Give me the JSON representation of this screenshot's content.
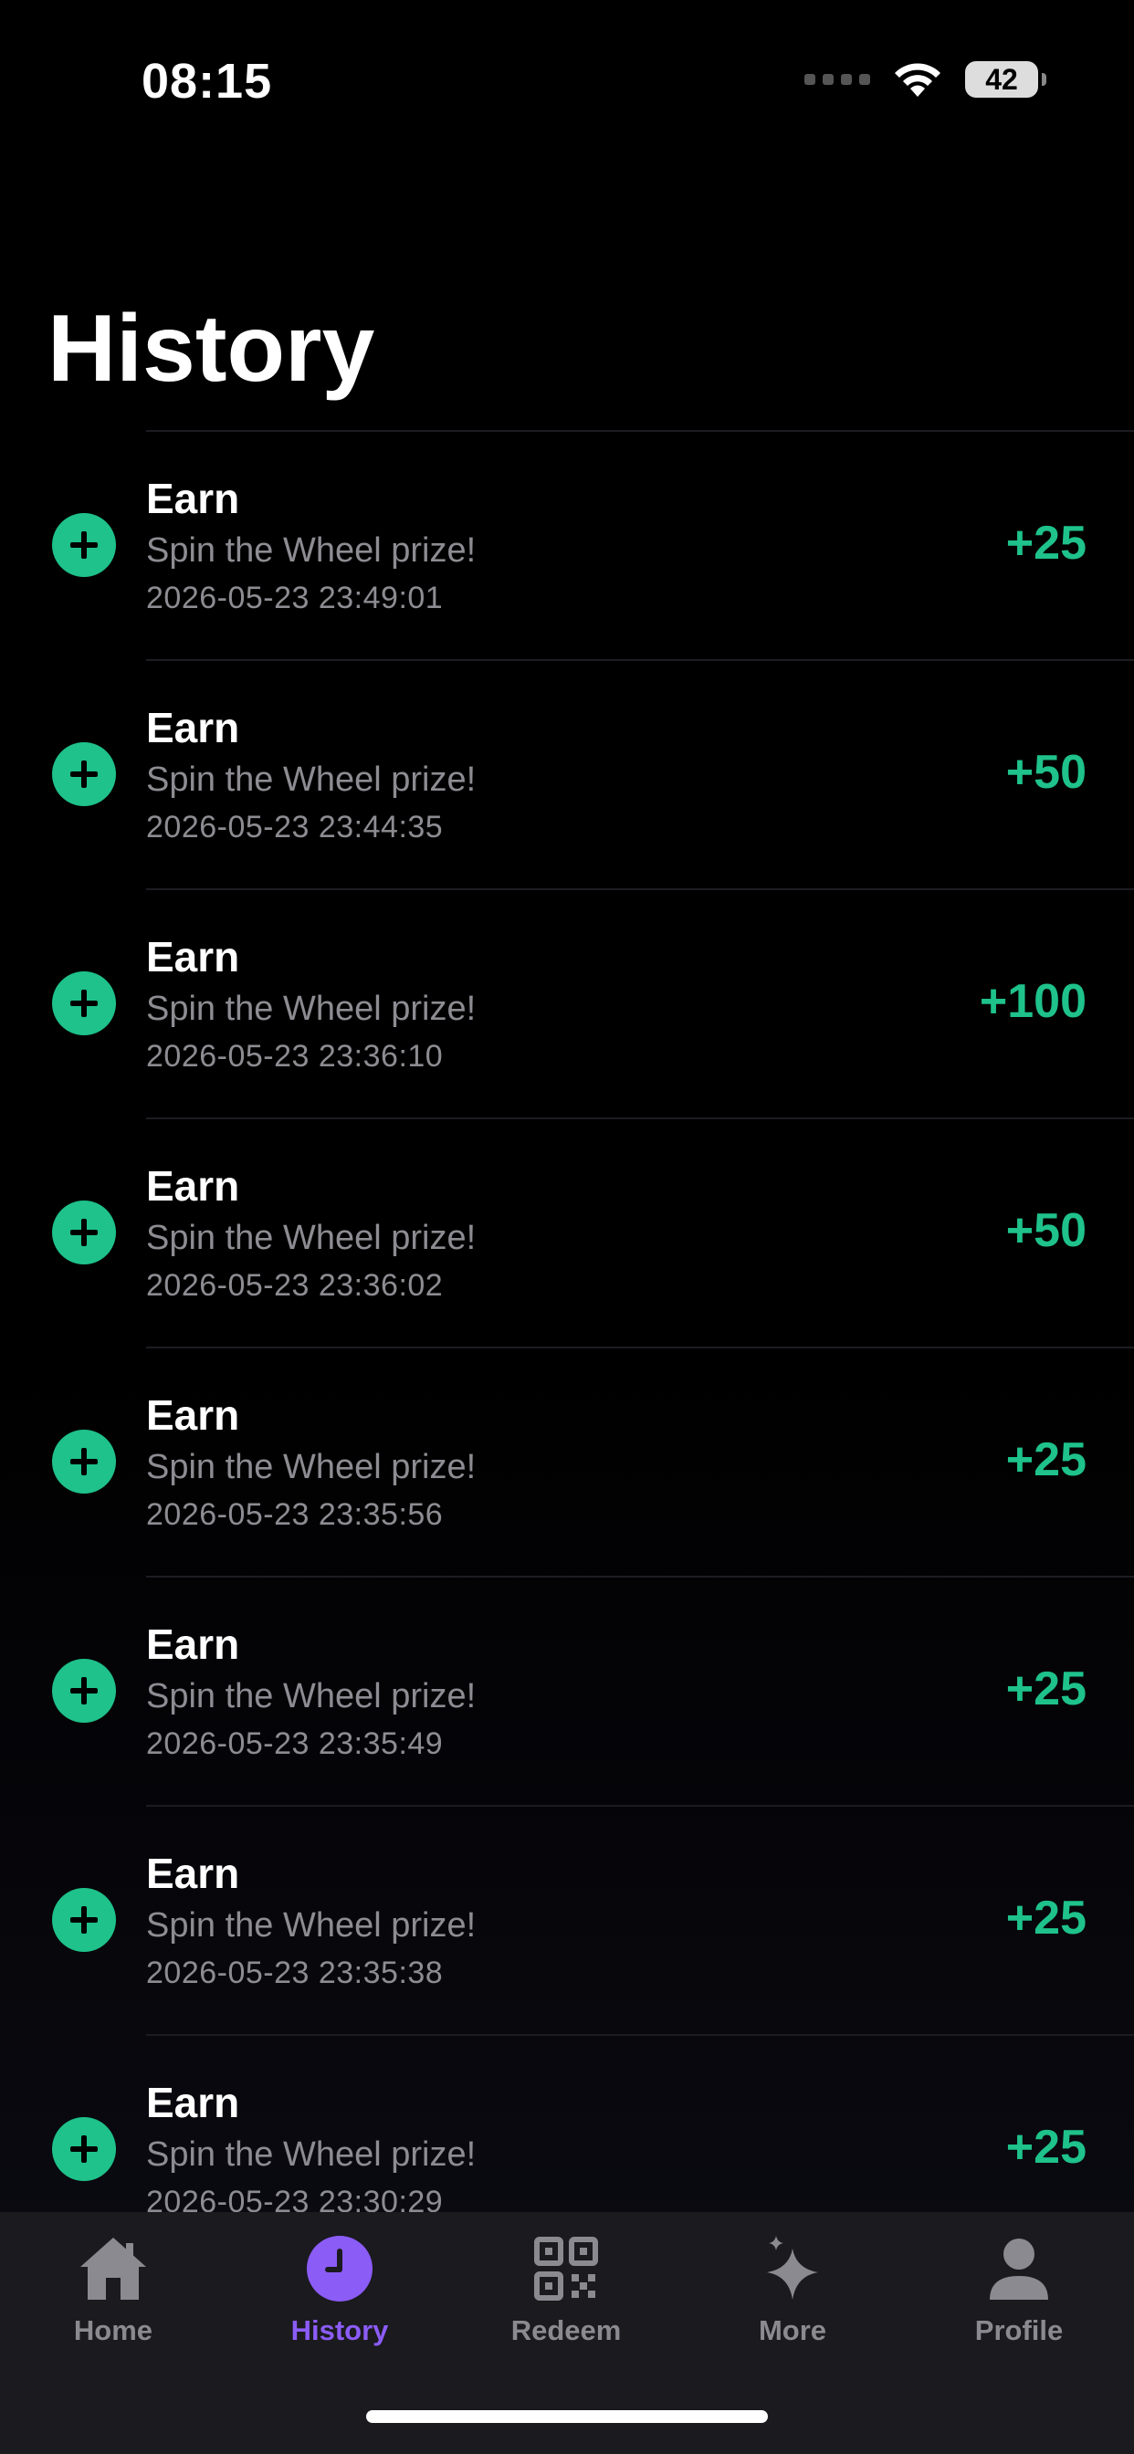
{
  "status_bar": {
    "time": "08:15",
    "battery": "42"
  },
  "page": {
    "title": "History"
  },
  "history": [
    {
      "title": "Earn",
      "description": "Spin the Wheel prize!",
      "timestamp": "2026-05-23 23:49:01",
      "amount": "+25"
    },
    {
      "title": "Earn",
      "description": "Spin the Wheel prize!",
      "timestamp": "2026-05-23 23:44:35",
      "amount": "+50"
    },
    {
      "title": "Earn",
      "description": "Spin the Wheel prize!",
      "timestamp": "2026-05-23 23:36:10",
      "amount": "+100"
    },
    {
      "title": "Earn",
      "description": "Spin the Wheel prize!",
      "timestamp": "2026-05-23 23:36:02",
      "amount": "+50"
    },
    {
      "title": "Earn",
      "description": "Spin the Wheel prize!",
      "timestamp": "2026-05-23 23:35:56",
      "amount": "+25"
    },
    {
      "title": "Earn",
      "description": "Spin the Wheel prize!",
      "timestamp": "2026-05-23 23:35:49",
      "amount": "+25"
    },
    {
      "title": "Earn",
      "description": "Spin the Wheel prize!",
      "timestamp": "2026-05-23 23:35:38",
      "amount": "+25"
    },
    {
      "title": "Earn",
      "description": "Spin the Wheel prize!",
      "timestamp": "2026-05-23 23:30:29",
      "amount": "+25"
    }
  ],
  "tabs": [
    {
      "label": "Home",
      "icon": "home-icon",
      "active": false
    },
    {
      "label": "History",
      "icon": "clock-icon",
      "active": true
    },
    {
      "label": "Redeem",
      "icon": "qr-code-icon",
      "active": false
    },
    {
      "label": "More",
      "icon": "sparkles-icon",
      "active": false
    },
    {
      "label": "Profile",
      "icon": "person-icon",
      "active": false
    }
  ],
  "colors": {
    "accent_green": "#1ec28a",
    "accent_purple": "#8b5cf6",
    "background": "#000000",
    "muted_text": "#8c8c92",
    "tab_bar": "#1a1a1f"
  }
}
